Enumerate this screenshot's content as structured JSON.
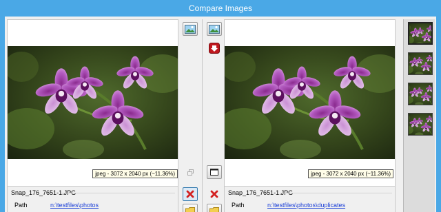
{
  "window": {
    "title": "Compare Images"
  },
  "left_image": {
    "info": "jpeg - 3072 x 2040 px (~11.36%)",
    "file_name": "Snap_176_7651-1.JPG",
    "path_label": "Path",
    "path": "n:\\testfiles\\photos"
  },
  "right_image": {
    "info": "jpeg - 3072 x 2040 px (~11.36%)",
    "file_name": "Snap_176_7651-1.JPG",
    "path_label": "Path",
    "path": "n:\\testfiles\\photos\\duplicates"
  },
  "toolbar_left": [
    "image-view-icon",
    "restore-icon",
    "delete-icon",
    "folder-icon"
  ],
  "toolbar_right": [
    "image-view-icon",
    "next-down-icon",
    "fit-window-icon",
    "delete-icon",
    "folder-icon"
  ],
  "thumbnails": [
    "thumbnail-1",
    "thumbnail-2",
    "thumbnail-3",
    "thumbnail-4"
  ],
  "colors": {
    "titlebar": "#4aa8e6",
    "delete_red": "#d32020",
    "link_blue": "#1b3fd8",
    "next_red": "#c0181e"
  }
}
